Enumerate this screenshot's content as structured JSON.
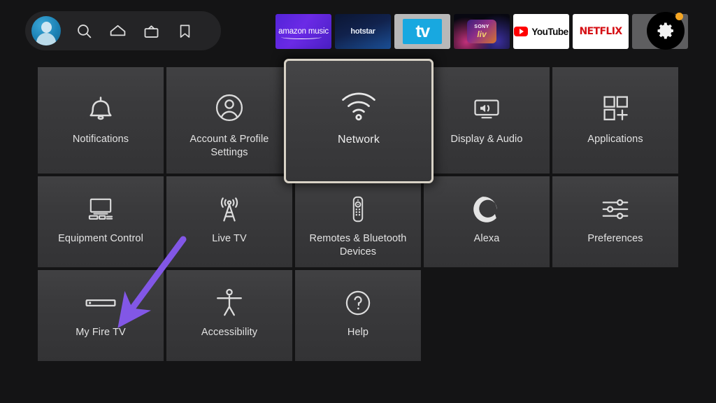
{
  "topbar": {
    "nav": [
      {
        "name": "profile-avatar",
        "label": "Profile"
      },
      {
        "name": "search-icon",
        "label": "Search"
      },
      {
        "name": "home-icon",
        "label": "Home"
      },
      {
        "name": "live-tv-icon",
        "label": "Live TV"
      },
      {
        "name": "bookmark-icon",
        "label": "Watchlist"
      }
    ],
    "apps": [
      {
        "name": "amazon-music-app",
        "label": "amazon music"
      },
      {
        "name": "hotstar-app",
        "label": "hotstar"
      },
      {
        "name": "apple-tv-app",
        "label": "tv"
      },
      {
        "name": "sony-liv-app",
        "label": "SONY",
        "sub": "liv"
      },
      {
        "name": "youtube-app",
        "label": "YouTube"
      },
      {
        "name": "netflix-app",
        "label": "NETFLIX"
      },
      {
        "name": "add-apps-button",
        "label": ""
      }
    ],
    "settings_button": {
      "name": "settings-gear-button",
      "label": "Settings",
      "has_badge": true,
      "badge_color": "#f5a623"
    }
  },
  "grid": {
    "rows": [
      [
        {
          "id": "notifications",
          "label": "Notifications",
          "icon": "bell-icon"
        },
        {
          "id": "account-profile-settings",
          "label": "Account & Profile Settings",
          "icon": "person-circle-icon"
        },
        {
          "id": "network",
          "label": "Network",
          "icon": "wifi-icon",
          "focused": true
        },
        {
          "id": "display-audio",
          "label": "Display & Audio",
          "icon": "tv-speaker-icon"
        },
        {
          "id": "applications",
          "label": "Applications",
          "icon": "app-squares-icon"
        }
      ],
      [
        {
          "id": "equipment-control",
          "label": "Equipment Control",
          "icon": "monitor-equipment-icon"
        },
        {
          "id": "live-tv",
          "label": "Live TV",
          "icon": "antenna-tower-icon"
        },
        {
          "id": "remotes-bluetooth-devices",
          "label": "Remotes & Bluetooth Devices",
          "icon": "remote-control-icon"
        },
        {
          "id": "alexa",
          "label": "Alexa",
          "icon": "alexa-ring-icon"
        },
        {
          "id": "preferences",
          "label": "Preferences",
          "icon": "sliders-icon"
        }
      ],
      [
        {
          "id": "my-fire-tv",
          "label": "My Fire TV",
          "icon": "fire-tv-stick-icon"
        },
        {
          "id": "accessibility",
          "label": "Accessibility",
          "icon": "accessibility-person-icon"
        },
        {
          "id": "help",
          "label": "Help",
          "icon": "question-circle-icon"
        }
      ]
    ]
  },
  "annotation": {
    "name": "purple-arrow-annotation",
    "color": "#8257e6",
    "points_to": "my-fire-tv"
  },
  "colors": {
    "background": "#141415",
    "tile": "#3a3a3c",
    "focus_border": "#d8d2c6",
    "text": "#e3e3e3",
    "accent_orange": "#f5a623",
    "arrow_purple": "#8257e6"
  }
}
